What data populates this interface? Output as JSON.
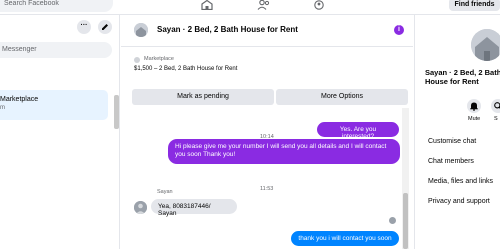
{
  "topbar": {
    "search_placeholder": "Search Facebook",
    "find_friends_label": "Find friends"
  },
  "left_panel": {
    "more_label": "···",
    "search_placeholder": "Messenger",
    "active_conversation": {
      "title_fragment": "Marketplace",
      "subtitle_fragment": "m"
    }
  },
  "conversation": {
    "title": "Sayan · 2 Bed, 2 Bath House for Rent",
    "info_label": "i",
    "listing": {
      "source": "Marketplace",
      "description": "$1,500 – 2 Bed, 2 Bath House for Rent"
    },
    "buttons": {
      "mark_pending": "Mark as pending",
      "more_options": "More Options"
    },
    "messages": [
      {
        "type": "timestamp",
        "text": "10:14"
      },
      {
        "type": "outgoing",
        "text": "Yes. Are you interested?"
      },
      {
        "type": "outgoing",
        "text": "Hi please give me your number I will send you all details and I will contact you soon Thank you!"
      },
      {
        "type": "timestamp",
        "text": "11:53"
      },
      {
        "type": "incoming",
        "sender": "Sayan",
        "text": "Yea, 8083187446/ Sayan"
      },
      {
        "type": "outgoing",
        "text": "thank you i will contact you soon"
      }
    ]
  },
  "right_panel": {
    "title": "Sayan · 2 Bed, 2 Bath House for Rent",
    "actions": {
      "mute_label": "Mute",
      "search_label": "S"
    },
    "menu_items": [
      "Customise chat",
      "Chat members",
      "Media, files and links",
      "Privacy and support"
    ]
  },
  "colors": {
    "accent_purple": "#8a2be2",
    "accent_blue": "#0084ff",
    "bubble_incoming": "#e4e6eb",
    "button_gray": "#e4e6eb",
    "active_item": "#e7f3ff"
  }
}
